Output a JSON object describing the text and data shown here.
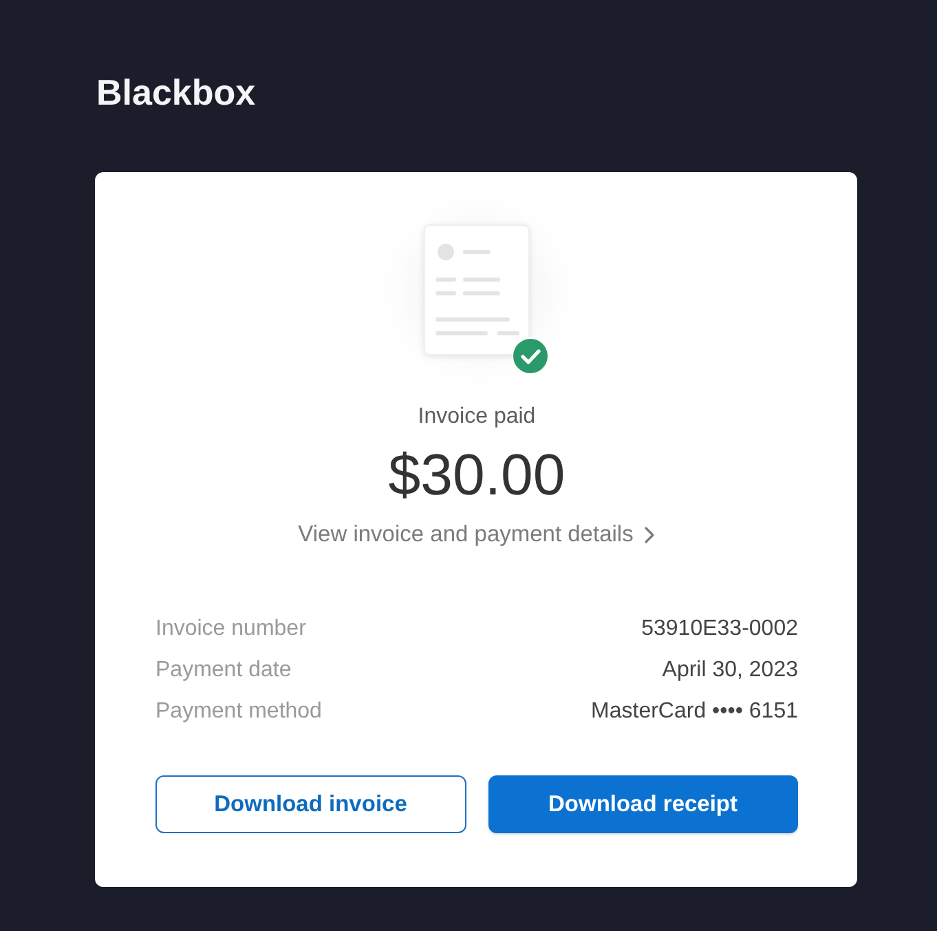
{
  "brand": {
    "title": "Blackbox"
  },
  "invoice": {
    "status": "Invoice paid",
    "amount": "$30.00",
    "details_link": "View invoice and payment details"
  },
  "details": [
    {
      "label": "Invoice number",
      "value": "53910E33-0002"
    },
    {
      "label": "Payment date",
      "value": "April 30, 2023"
    },
    {
      "label": "Payment method",
      "value": "MasterCard •••• 6151"
    }
  ],
  "buttons": [
    {
      "label": "Download invoice",
      "kind": "outline"
    },
    {
      "label": "Download receipt",
      "kind": "primary"
    }
  ]
}
